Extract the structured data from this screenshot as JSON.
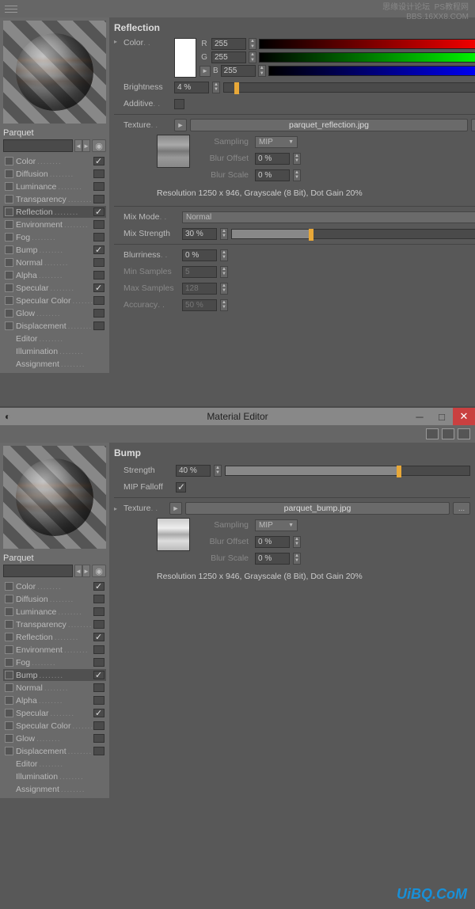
{
  "watermark_top_cn": "思缘设计论坛",
  "watermark_top_en1": "PS教程网",
  "watermark_top_en2": "BBS.16XX8.COM",
  "watermark_bottom": "UiBQ.CoM",
  "material_name": "Parquet",
  "channels": [
    {
      "name": "Color",
      "has_chk": true,
      "on": true
    },
    {
      "name": "Diffusion",
      "has_chk": true,
      "on": false
    },
    {
      "name": "Luminance",
      "has_chk": true,
      "on": false
    },
    {
      "name": "Transparency",
      "has_chk": true,
      "on": false
    },
    {
      "name": "Reflection",
      "has_chk": true,
      "on": true,
      "selected_top": true
    },
    {
      "name": "Environment",
      "has_chk": true,
      "on": false
    },
    {
      "name": "Fog",
      "has_chk": true,
      "on": false
    },
    {
      "name": "Bump",
      "has_chk": true,
      "on": true,
      "selected_bot": true
    },
    {
      "name": "Normal",
      "has_chk": true,
      "on": false
    },
    {
      "name": "Alpha",
      "has_chk": true,
      "on": false
    },
    {
      "name": "Specular",
      "has_chk": true,
      "on": true
    },
    {
      "name": "Specular Color",
      "has_chk": true,
      "on": false
    },
    {
      "name": "Glow",
      "has_chk": true,
      "on": false
    },
    {
      "name": "Displacement",
      "has_chk": true,
      "on": false
    },
    {
      "name": "Editor",
      "has_chk": false
    },
    {
      "name": "Illumination",
      "has_chk": false
    },
    {
      "name": "Assignment",
      "has_chk": false
    }
  ],
  "top": {
    "title": "Reflection",
    "labels": {
      "color": "Color",
      "brightness": "Brightness",
      "additive": "Additive",
      "texture": "Texture",
      "sampling": "Sampling",
      "blur_offset": "Blur Offset",
      "blur_scale": "Blur Scale",
      "mix_mode": "Mix Mode",
      "mix_strength": "Mix Strength",
      "blurriness": "Blurriness",
      "min_samples": "Min Samples",
      "max_samples": "Max Samples",
      "accuracy": "Accuracy"
    },
    "rgb": {
      "r_label": "R",
      "g_label": "G",
      "b_label": "B",
      "r": "255",
      "g": "255",
      "b": "255"
    },
    "brightness": "4 %",
    "texture_file": "parquet_reflection.jpg",
    "sampling": "MIP",
    "blur_offset": "0 %",
    "blur_scale": "0 %",
    "resolution": "Resolution 1250 x 946, Grayscale (8 Bit), Dot Gain 20%",
    "mix_mode": "Normal",
    "mix_strength": "30 %",
    "blurriness": "0 %",
    "min_samples": "5",
    "max_samples": "128",
    "accuracy": "50 %",
    "color_hex": "#ffffff"
  },
  "bottom": {
    "window_title": "Material Editor",
    "title": "Bump",
    "labels": {
      "strength": "Strength",
      "mip": "MIP Falloff",
      "texture": "Texture",
      "sampling": "Sampling",
      "blur_offset": "Blur Offset",
      "blur_scale": "Blur Scale"
    },
    "strength": "40 %",
    "texture_file": "parquet_bump.jpg",
    "sampling": "MIP",
    "blur_offset": "0 %",
    "blur_scale": "0 %",
    "resolution": "Resolution 1250 x 946, Grayscale (8 Bit), Dot Gain 20%"
  }
}
